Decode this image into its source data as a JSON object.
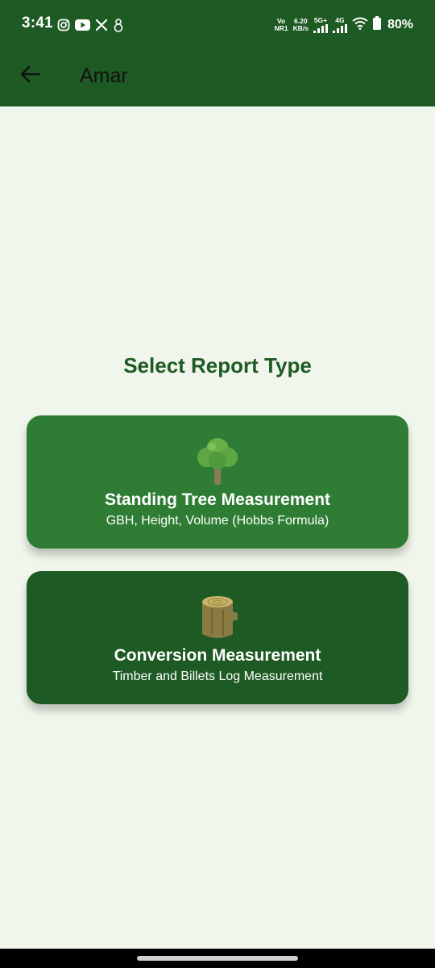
{
  "status_bar": {
    "time": "3:41",
    "volte_top": "Vo",
    "volte_bottom": "NR1",
    "speed_value": "6.20",
    "speed_unit": "KB/s",
    "net_5g": "5G+",
    "net_4g": "4G",
    "battery": "80%",
    "left_icons": [
      "instagram-icon",
      "youtube-icon",
      "x-icon",
      "snowman-icon"
    ]
  },
  "app_bar": {
    "title": "Amar",
    "back_icon": "arrow-back-icon"
  },
  "main": {
    "heading": "Select Report Type",
    "cards": [
      {
        "title": "Standing Tree Measurement",
        "subtitle": "GBH, Height, Volume (Hobbs Formula)",
        "icon": "tree-icon",
        "color": "#2f7d34"
      },
      {
        "title": "Conversion Measurement",
        "subtitle": "Timber and Billets Log Measurement",
        "icon": "log-icon",
        "color": "#1e5a23"
      }
    ]
  },
  "colors": {
    "primary_dark": "#1e5a23",
    "primary": "#2f7d34",
    "background": "#f1f6ec"
  }
}
